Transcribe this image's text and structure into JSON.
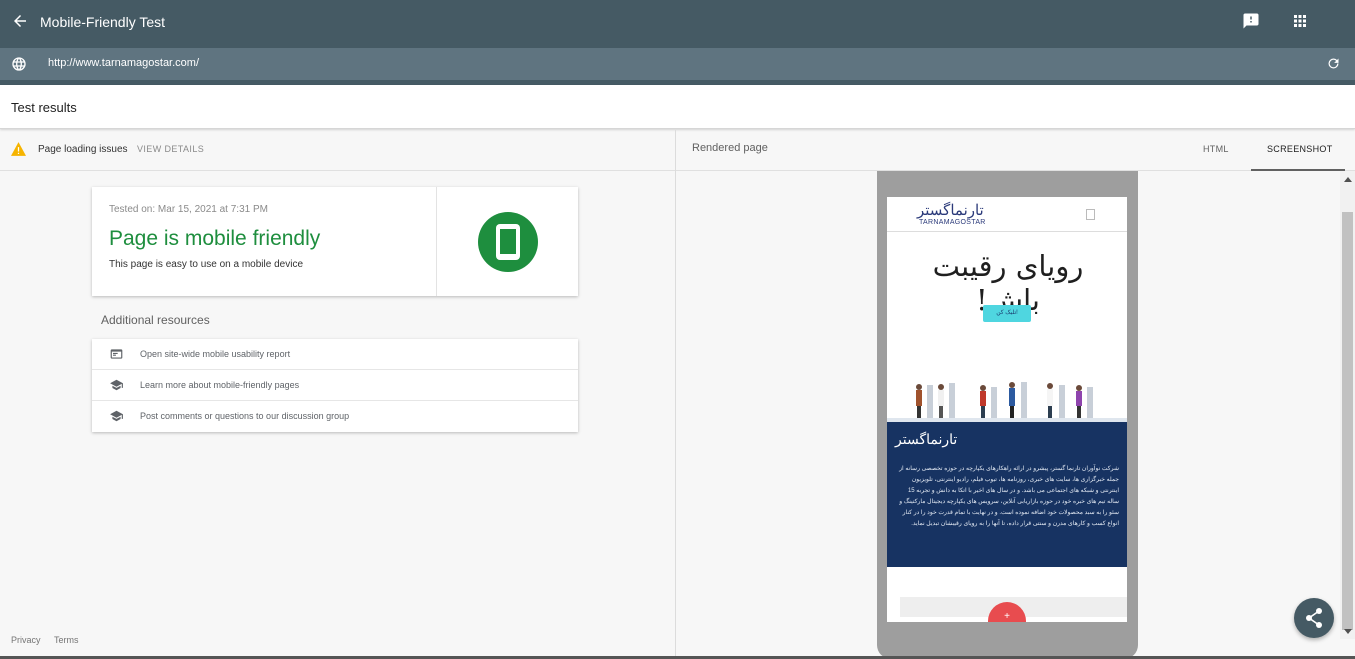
{
  "app": {
    "title": "Mobile-Friendly Test",
    "url": "http://www.tarnamagostar.com/"
  },
  "results": {
    "heading": "Test results",
    "issues_label": "Page loading issues",
    "view_details": "VIEW DETAILS",
    "tested_on": "Tested on: Mar 15, 2021 at 7:31 PM",
    "verdict": "Page is mobile friendly",
    "verdict_sub": "This page is easy to use on a mobile device",
    "additional_title": "Additional resources",
    "resources": [
      {
        "icon": "report-icon",
        "label": "Open site-wide mobile usability report"
      },
      {
        "icon": "school-icon",
        "label": "Learn more about mobile-friendly pages"
      },
      {
        "icon": "school-icon",
        "label": "Post comments or questions to our discussion group"
      }
    ],
    "footer": {
      "privacy": "Privacy",
      "terms": "Terms"
    }
  },
  "rendered": {
    "label": "Rendered page",
    "tabs": [
      "HTML",
      "SCREENSHOT"
    ],
    "active_tab": "SCREENSHOT"
  },
  "site_preview": {
    "logo": "تارنماگستر",
    "logo_en": "TARNAMAGOSTAR",
    "hero": "رویای رقیبت باش!",
    "cta": "تلیک کن!",
    "dark_logo": "تارنماگستر",
    "about": "شرکت نوآوران تارنما گستر، پیشرو در ارائه راهکارهای یکپارچه در حوزه تخصصی رسانه از جمله خبرگزاری ها، سایت های خبری، روزنامه ها، تیوب فیلم، رادیو اینترنتی، تلویزیون اینترنتی و شبکه های اجتماعی می باشد. و در سال های اخیر با اتکا به دانش و تجربه 15 ساله تیم های خبره خود در حوزه بازاریابی آنلاین، سرویس های یکپارچه دیجیتال مارکتینگ و سئو را به سبد محصولات خود اضافه نموده است. و در نهایت با تمام قدرت خود را در کنار انواع کسب و کارهای مدرن و سنتی قرار داده، تا آنها را به رویای رقیبشان تبدیل نماید.",
    "fab": "+"
  },
  "colors": {
    "header": "#455a64",
    "url_bar": "#5f7480",
    "success": "#1e8e3e",
    "warning": "#f6b400",
    "preview_dark": "#173362",
    "cta": "#4fd6e0",
    "fab": "#e84c4f"
  }
}
